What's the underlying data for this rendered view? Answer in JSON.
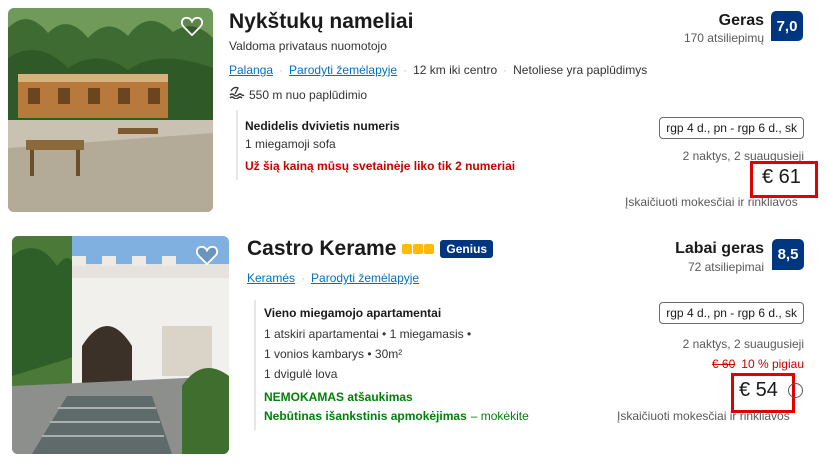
{
  "listings": [
    {
      "name": "Nykštukų nameliai",
      "host": "Valdoma privataus nuomotojo",
      "location_link": "Palanga",
      "map_link": "Parodyti žemėlapyje",
      "distance": "12 km iki centro",
      "beach_near": "Netoliese yra paplūdimys",
      "beach_distance": "550 m nuo paplūdimio",
      "score_word": "Geras",
      "reviews": "170 atsiliepimų",
      "score": "7,0",
      "room_name": "Nedidelis dvivietis numeris",
      "room_detail": "1 miegamoji sofa",
      "availability_warning": "Už šią kainą mūsų svetainėje liko tik 2 numeriai",
      "dates": "rgp 4 d., pn - rgp 6 d., sk",
      "nights": "2 naktys, 2 suaugusieji",
      "price": "€ 61",
      "taxes": "Įskaičiuoti mokesčiai ir rinkliavos"
    },
    {
      "name": "Castro Kerame",
      "genius": "Genius",
      "location_link": "Keramés",
      "map_link": "Parodyti žemėlapyje",
      "score_word": "Labai geras",
      "reviews": "72 atsiliepimai",
      "score": "8,5",
      "room_name": "Vieno miegamojo apartamentai",
      "room_details": [
        "1 atskiri apartamentai • 1 miegamasis •",
        "1 vonios kambarys • 30m²",
        "1 dvigulė lova"
      ],
      "free_cancel": "NEMOKAMAS atšaukimas",
      "prepay": "Nebūtinas išankstinis apmokėjimas",
      "prepay_suffix": "– mokėkite",
      "dates": "rgp 4 d., pn - rgp 6 d., sk",
      "nights": "2 naktys, 2 suaugusieji",
      "old_price": "€ 60",
      "discount": "10 % pigiau",
      "price": "€ 54",
      "taxes": "Įskaičiuoti mokesčiai ir rinkliavos"
    }
  ],
  "colors": {
    "link": "#0071c2",
    "badge": "#003580",
    "warning": "#cc0000",
    "green": "#008009",
    "highlight_box": "#e00000",
    "star": "#febb02"
  }
}
